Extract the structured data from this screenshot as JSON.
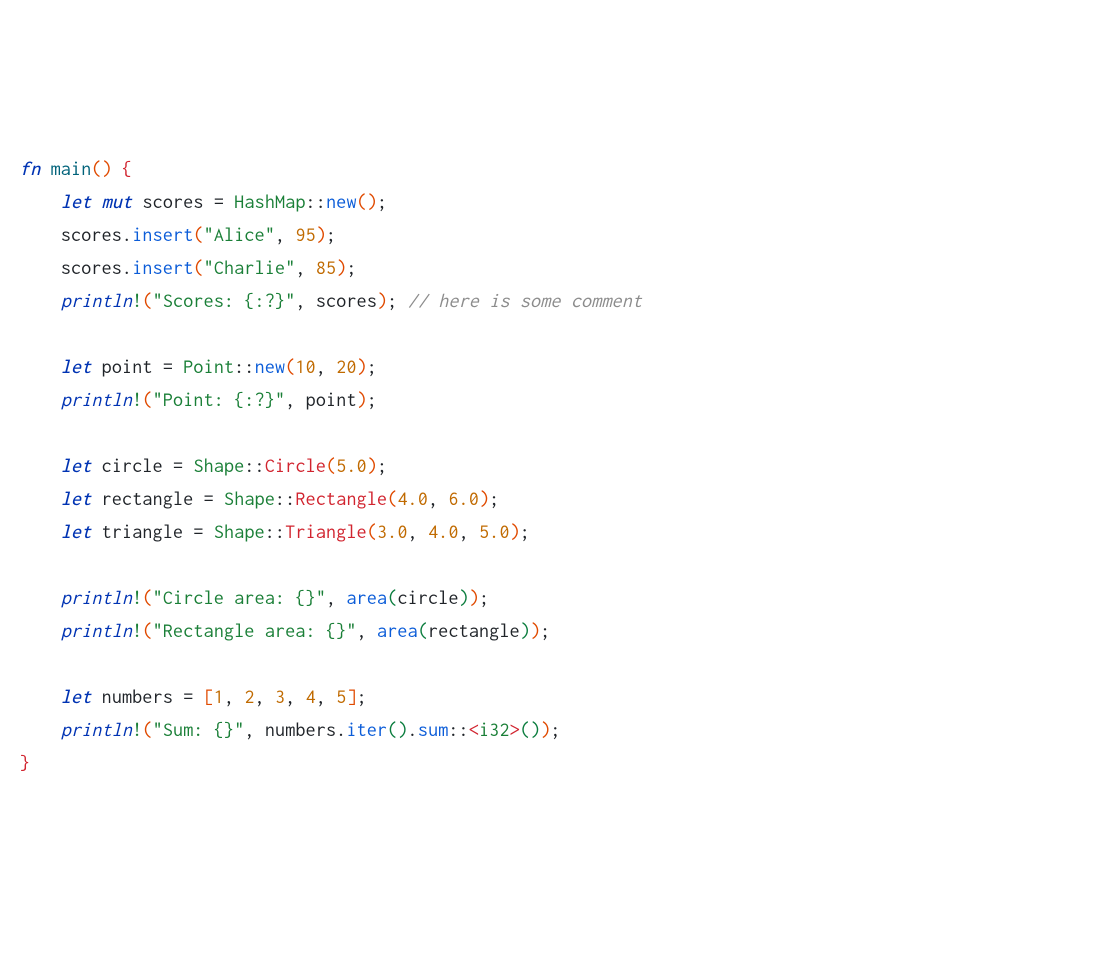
{
  "lines": {
    "l1": {
      "kw_fn": "fn",
      "fn_main": "main"
    },
    "l2": {
      "kw_let": "let",
      "kw_mut": "mut",
      "id_scores": "scores",
      "eq": " = ",
      "ty_hashmap": "HashMap",
      "cc": "::",
      "m_new": "new",
      "semi": ";"
    },
    "l3": {
      "id_scores": "scores",
      "dot": ".",
      "m_insert": "insert",
      "str_alice": "\"Alice\"",
      "comma": ", ",
      "num_95": "95",
      "semi": ";"
    },
    "l4": {
      "id_scores": "scores",
      "dot": ".",
      "m_insert": "insert",
      "str_charlie": "\"Charlie\"",
      "comma": ", ",
      "num_85": "85",
      "semi": ";"
    },
    "l5": {
      "mac_println": "println",
      "bang": "!",
      "str_scores": "\"Scores: {:?}\"",
      "comma": ", ",
      "id_scores": "scores",
      "semi": ";",
      "comment": " // here is some comment"
    },
    "l6": {
      "kw_let": "let",
      "id_point": "point",
      "eq": " = ",
      "ty_point": "Point",
      "cc": "::",
      "m_new": "new",
      "num_10": "10",
      "comma": ", ",
      "num_20": "20",
      "semi": ";"
    },
    "l7": {
      "mac_println": "println",
      "bang": "!",
      "str_point": "\"Point: {:?}\"",
      "comma": ", ",
      "id_point": "point",
      "semi": ";"
    },
    "l8": {
      "kw_let": "let",
      "id_circle": "circle",
      "eq": " = ",
      "ty_shape": "Shape",
      "cc": "::",
      "variant": "Circle",
      "num_5": "5.0",
      "semi": ";"
    },
    "l9": {
      "kw_let": "let",
      "id_rect": "rectangle",
      "eq": " = ",
      "ty_shape": "Shape",
      "cc": "::",
      "variant": "Rectangle",
      "num_4": "4.0",
      "comma": ", ",
      "num_6": "6.0",
      "semi": ";"
    },
    "l10": {
      "kw_let": "let",
      "id_tri": "triangle",
      "eq": " = ",
      "ty_shape": "Shape",
      "cc": "::",
      "variant": "Triangle",
      "num_3": "3.0",
      "comma1": ", ",
      "num_4": "4.0",
      "comma2": ", ",
      "num_5": "5.0",
      "semi": ";"
    },
    "l11": {
      "mac_println": "println",
      "bang": "!",
      "str_ca": "\"Circle area: {}\"",
      "comma": ", ",
      "fn_area": "area",
      "id_circle": "circle",
      "semi": ";"
    },
    "l12": {
      "mac_println": "println",
      "bang": "!",
      "str_ra": "\"Rectangle area: {}\"",
      "comma": ", ",
      "fn_area": "area",
      "id_rect": "rectangle",
      "semi": ";"
    },
    "l13": {
      "kw_let": "let",
      "id_numbers": "numbers",
      "eq": " = ",
      "n1": "1",
      "c1": ", ",
      "n2": "2",
      "c2": ", ",
      "n3": "3",
      "c3": ", ",
      "n4": "4",
      "c4": ", ",
      "n5": "5",
      "semi": ";"
    },
    "l14": {
      "mac_println": "println",
      "bang": "!",
      "str_sum": "\"Sum: {}\"",
      "comma": ", ",
      "id_numbers": "numbers",
      "dot1": ".",
      "m_iter": "iter",
      "dot2": ".",
      "m_sum": "sum",
      "cc": "::",
      "lt": "<",
      "ty_i32": "i32",
      "gt": ">",
      "semi": ";"
    }
  }
}
